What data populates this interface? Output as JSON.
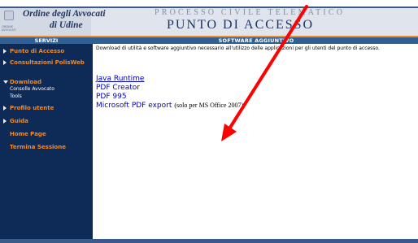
{
  "header": {
    "org_line1": "Ordine degli Avvocati",
    "org_line2": "di Udine",
    "logo_caption": "ORDINE AVVOCATI",
    "app_subtitle": "PROCESSO CIVILE TELEMATICO",
    "app_title": "PUNTO DI ACCESSO"
  },
  "section": {
    "left_title": "SERVIZI",
    "right_title": "SOFTWARE AGGIUNTIVO"
  },
  "sidebar": {
    "items": [
      {
        "label": "Punto di Accesso",
        "icon": "arrow-right-icon"
      },
      {
        "label": "Consultazioni PolisWeb",
        "icon": "arrow-right-icon"
      },
      {
        "label": "Download",
        "icon": "arrow-down-icon",
        "expanded": true,
        "sub": [
          "Consolle Avvocato",
          "Tools"
        ]
      },
      {
        "label": "Profilo utente",
        "icon": "arrow-right-icon"
      },
      {
        "label": "Guida",
        "icon": "arrow-right-icon"
      },
      {
        "label": "Home Page"
      },
      {
        "label": "Termina Sessione"
      }
    ]
  },
  "content": {
    "intro": "Download di utilità e software aggiuntivo necessario all'utilizzo delle applicazioni per gli utenti del punto di accesso.",
    "downloads": [
      {
        "label": "Java Runtime"
      },
      {
        "label": "PDF Creator"
      },
      {
        "label": "PDF 995"
      },
      {
        "label": "Microsoft PDF export",
        "note": "(solo per MS Office 2007)"
      }
    ]
  },
  "colors": {
    "sidebar_bg": "#0e2b57",
    "section_bar": "#2f5f93",
    "accent_orange": "#f08a28",
    "link": "#0000cc",
    "annotation_arrow": "#ff0000"
  }
}
